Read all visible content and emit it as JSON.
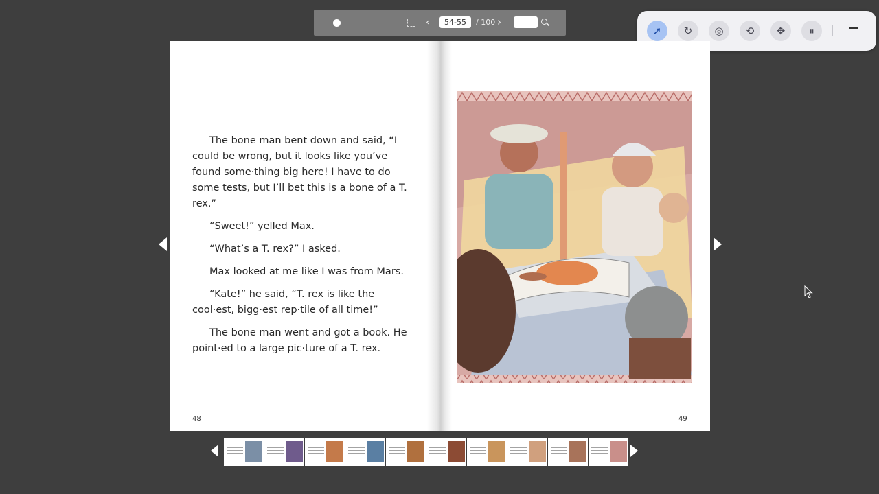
{
  "toolbar": {
    "page_value": "54-55",
    "page_total": "/ 100",
    "search_value": ""
  },
  "tools": [
    {
      "icon": "select-pointer-icon",
      "active": true
    },
    {
      "icon": "rotate-icon",
      "active": false
    },
    {
      "icon": "ripple-pointer-icon",
      "active": false
    },
    {
      "icon": "refresh-icon",
      "active": false
    },
    {
      "icon": "move-icon",
      "active": false
    },
    {
      "icon": "pause-icon",
      "active": false
    }
  ],
  "book": {
    "left_page_number": "48",
    "right_page_number": "49",
    "paragraphs": [
      "The bone man bent down and said, “I could be wrong, but it looks like you’ve found some·thing big here! I have to do some tests, but I’ll bet this is a bone of a T. rex.”",
      "“Sweet!” yelled Max.",
      "“What’s a T. rex?” I asked.",
      "Max looked at me like I was from Mars.",
      "“Kate!” he said, “T. rex is like the cool·est, bigg·est rep·tile of all time!”",
      "The bone man went and got a book. He point·ed to a large pic·ture of a T. rex."
    ]
  },
  "colors": {
    "background": "#3e3e3e",
    "toolbar": "#7a7a7a",
    "active_tool": "#a7c3f3",
    "illustration_frame": "#c98f8a"
  },
  "thumbnails_count": 10
}
